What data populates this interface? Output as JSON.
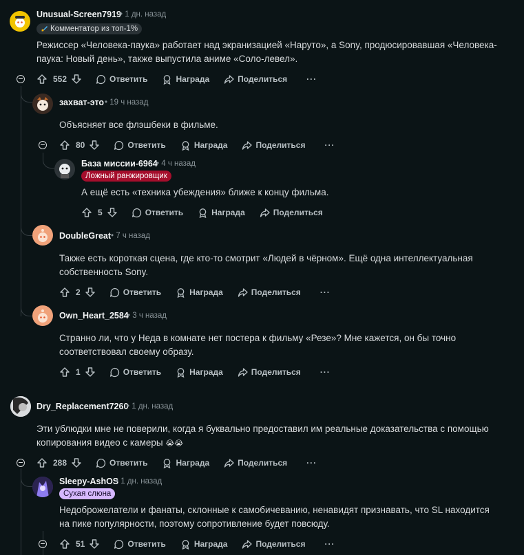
{
  "labels": {
    "reply": "Ответить",
    "award": "Награда",
    "share": "Поделиться"
  },
  "comments": [
    {
      "username": "Unusual-Screen7919",
      "time": "1 дн. назад",
      "flair": "Комментатор из топ-1%",
      "body": [
        "Режиссер «Человека-паука» работает над экранизацией «Наруто», а Sony, продюсировавшая «Человека-",
        "паука: Новый день», также выпустила аниме «Соло-левел»."
      ],
      "votes": "552"
    },
    {
      "username": "захват-это",
      "time": "19 ч назад",
      "body": [
        "Объясняет все флэшбеки в фильме."
      ],
      "votes": "80"
    },
    {
      "username": "База миссии-6964",
      "time": "4 ч назад",
      "flair": "Ложный ранжировщик",
      "body": [
        "А ещё есть «техника убеждения» ближе к концу фильма."
      ],
      "votes": "5"
    },
    {
      "username": "DoubleGreat",
      "time": "7 ч назад",
      "body": [
        "Также есть короткая сцена, где кто-то смотрит «Людей в чёрном». Ещё одна интеллектуальная",
        "собственность Sony."
      ],
      "votes": "2"
    },
    {
      "username": "Own_Heart_2584",
      "time": "3 ч назад",
      "body": [
        "Странно ли, что у Неда в комнате нет постера к фильму «Резе»? Мне кажется, он бы точно",
        "соответствовал своему образу."
      ],
      "votes": "1"
    },
    {
      "username": "Dry_Replacement7260",
      "time": "1 дн. назад",
      "body": [
        "Эти ублюдки мне не поверили, когда я буквально предоставил им реальные доказательства с помощью",
        "копирования видео с камеры"
      ],
      "emoji": "😭😭",
      "votes": "288"
    },
    {
      "username": "Sleepy-AshOS",
      "time": "1 дн. назад",
      "flair": "Сухая слюна",
      "body": [
        "Недоброжелатели и фанаты, склонные к самобичеванию, ненавидят признавать, что SL находится",
        "на пике популярности, поэтому сопротивление будет повсюду."
      ],
      "votes": "51"
    }
  ],
  "colors": {
    "bg": "#0b1416",
    "flair_top": "#2a3236",
    "flair_false": "#a50e2c",
    "flair_dry": "#d6b8ff"
  }
}
